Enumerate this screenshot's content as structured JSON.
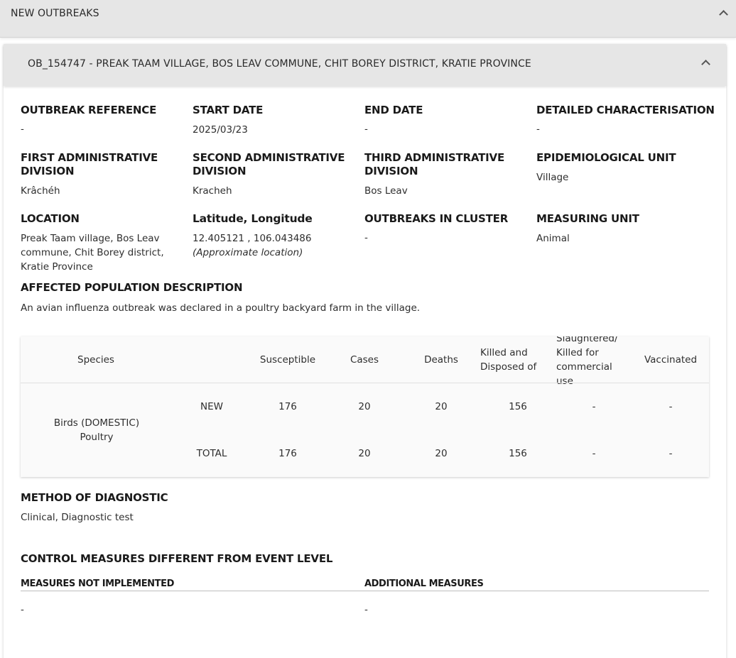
{
  "section": {
    "title": "NEW OUTBREAKS"
  },
  "outbreak": {
    "header": "OB_154747 - PREAK TAAM VILLAGE, BOS LEAV COMMUNE, CHIT BOREY DISTRICT, KRATIE PROVINCE",
    "fields": {
      "outbreak_reference": {
        "label": "OUTBREAK REFERENCE",
        "value": "-"
      },
      "start_date": {
        "label": "START DATE",
        "value": "2025/03/23"
      },
      "end_date": {
        "label": "END DATE",
        "value": "-"
      },
      "detailed_characterisation": {
        "label": "DETAILED CHARACTERISATION",
        "value": "-"
      },
      "first_admin": {
        "label_line1": "FIRST ADMINISTRATIVE",
        "label_line2": "DIVISION",
        "value": "Krâchéh"
      },
      "second_admin": {
        "label_line1": "SECOND ADMINISTRATIVE",
        "label_line2": "DIVISION",
        "value": "Kracheh"
      },
      "third_admin": {
        "label_line1": "THIRD ADMINISTRATIVE",
        "label_line2": "DIVISION",
        "value": "Bos Leav"
      },
      "epi_unit": {
        "label": "EPIDEMIOLOGICAL UNIT",
        "value": "Village"
      },
      "location": {
        "label": "LOCATION",
        "value_line1": "Preak Taam village, Bos Leav",
        "value_line2": "commune, Chit Borey district,",
        "value_line3": "Kratie Province"
      },
      "lat_long": {
        "label": "Latitude, Longitude",
        "value": "12.405121 , 106.043486",
        "note": "(Approximate location)"
      },
      "outbreaks_in_cluster": {
        "label": "OUTBREAKS IN CLUSTER",
        "value": "-"
      },
      "measuring_unit": {
        "label": "MEASURING UNIT",
        "value": "Animal"
      },
      "affected_population": {
        "label": "AFFECTED POPULATION DESCRIPTION",
        "value": "An avian influenza outbreak was declared in a poultry backyard farm in the village."
      }
    },
    "table": {
      "headers": {
        "species": "Species",
        "susceptible": "Susceptible",
        "cases": "Cases",
        "deaths": "Deaths",
        "killed_line1": "Killed and",
        "killed_line2": "Disposed of",
        "slaughtered_line1": "Slaughtered/",
        "slaughtered_line2": "Killed for",
        "slaughtered_line3": "commercial",
        "slaughtered_line4": "use",
        "vaccinated": "Vaccinated"
      },
      "species_line1": "Birds (DOMESTIC)",
      "species_line2": "Poultry",
      "rows": [
        {
          "type": "NEW",
          "susceptible": "176",
          "cases": "20",
          "deaths": "20",
          "killed": "156",
          "slaughtered": "-",
          "vaccinated": "-"
        },
        {
          "type": "TOTAL",
          "susceptible": "176",
          "cases": "20",
          "deaths": "20",
          "killed": "156",
          "slaughtered": "-",
          "vaccinated": "-"
        }
      ]
    },
    "diagnostic": {
      "label": "METHOD OF DIAGNOSTIC",
      "value": "Clinical, Diagnostic test"
    },
    "control_measures": {
      "label": "CONTROL MEASURES DIFFERENT FROM EVENT LEVEL",
      "not_implemented": {
        "label": "MEASURES NOT IMPLEMENTED",
        "value": "-"
      },
      "additional": {
        "label": "ADDITIONAL MEASURES",
        "value": "-"
      }
    }
  }
}
